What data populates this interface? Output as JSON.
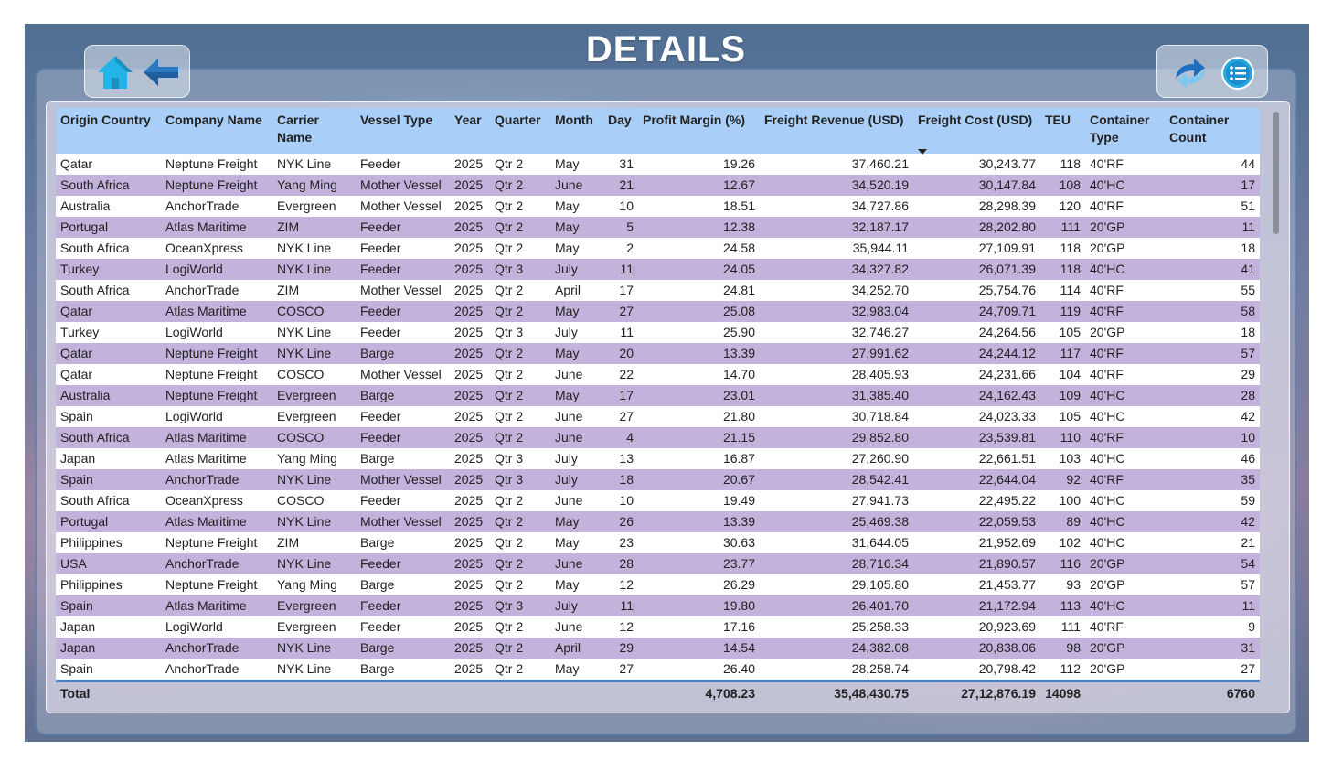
{
  "page": {
    "title": "DETAILS"
  },
  "nav": {
    "home_icon": "home-icon",
    "back_icon": "back-arrow-icon"
  },
  "tools": {
    "refresh_icon": "refresh-icon",
    "menu_icon": "list-menu-icon"
  },
  "colors": {
    "header_bg": "#a9cff8",
    "row_alt": "#c3b3dc",
    "row_base": "#ffffff",
    "total_rule": "#3b7fd0",
    "title": "#ffffff"
  },
  "table": {
    "columns": [
      "Origin Country",
      "Company Name",
      "Carrier Name",
      "Vessel Type",
      "Year",
      "Quarter",
      "Month",
      "Day",
      "Profit Margin (%)",
      "Freight Revenue (USD)",
      "Freight Cost (USD)",
      "TEU",
      "Container Type",
      "Container Count"
    ],
    "sorted_column": "Freight Cost (USD)",
    "sort_direction": "descending",
    "rows": [
      [
        "Qatar",
        "Neptune Freight",
        "NYK Line",
        "Feeder",
        "2025",
        "Qtr 2",
        "May",
        "31",
        "19.26",
        "37,460.21",
        "30,243.77",
        "118",
        "40'RF",
        "44"
      ],
      [
        "South Africa",
        "Neptune Freight",
        "Yang Ming",
        "Mother Vessel",
        "2025",
        "Qtr 2",
        "June",
        "21",
        "12.67",
        "34,520.19",
        "30,147.84",
        "108",
        "40'HC",
        "17"
      ],
      [
        "Australia",
        "AnchorTrade",
        "Evergreen",
        "Mother Vessel",
        "2025",
        "Qtr 2",
        "May",
        "10",
        "18.51",
        "34,727.86",
        "28,298.39",
        "120",
        "40'RF",
        "51"
      ],
      [
        "Portugal",
        "Atlas Maritime",
        "ZIM",
        "Feeder",
        "2025",
        "Qtr 2",
        "May",
        "5",
        "12.38",
        "32,187.17",
        "28,202.80",
        "111",
        "20'GP",
        "11"
      ],
      [
        "South Africa",
        "OceanXpress",
        "NYK Line",
        "Feeder",
        "2025",
        "Qtr 2",
        "May",
        "2",
        "24.58",
        "35,944.11",
        "27,109.91",
        "118",
        "20'GP",
        "18"
      ],
      [
        "Turkey",
        "LogiWorld",
        "NYK Line",
        "Feeder",
        "2025",
        "Qtr 3",
        "July",
        "11",
        "24.05",
        "34,327.82",
        "26,071.39",
        "118",
        "40'HC",
        "41"
      ],
      [
        "South Africa",
        "AnchorTrade",
        "ZIM",
        "Mother Vessel",
        "2025",
        "Qtr 2",
        "April",
        "17",
        "24.81",
        "34,252.70",
        "25,754.76",
        "114",
        "40'RF",
        "55"
      ],
      [
        "Qatar",
        "Atlas Maritime",
        "COSCO",
        "Feeder",
        "2025",
        "Qtr 2",
        "May",
        "27",
        "25.08",
        "32,983.04",
        "24,709.71",
        "119",
        "40'RF",
        "58"
      ],
      [
        "Turkey",
        "LogiWorld",
        "NYK Line",
        "Feeder",
        "2025",
        "Qtr 3",
        "July",
        "11",
        "25.90",
        "32,746.27",
        "24,264.56",
        "105",
        "20'GP",
        "18"
      ],
      [
        "Qatar",
        "Neptune Freight",
        "NYK Line",
        "Barge",
        "2025",
        "Qtr 2",
        "May",
        "20",
        "13.39",
        "27,991.62",
        "24,244.12",
        "117",
        "40'RF",
        "57"
      ],
      [
        "Qatar",
        "Neptune Freight",
        "COSCO",
        "Mother Vessel",
        "2025",
        "Qtr 2",
        "June",
        "22",
        "14.70",
        "28,405.93",
        "24,231.66",
        "104",
        "40'RF",
        "29"
      ],
      [
        "Australia",
        "Neptune Freight",
        "Evergreen",
        "Barge",
        "2025",
        "Qtr 2",
        "May",
        "17",
        "23.01",
        "31,385.40",
        "24,162.43",
        "109",
        "40'HC",
        "28"
      ],
      [
        "Spain",
        "LogiWorld",
        "Evergreen",
        "Feeder",
        "2025",
        "Qtr 2",
        "June",
        "27",
        "21.80",
        "30,718.84",
        "24,023.33",
        "105",
        "40'HC",
        "42"
      ],
      [
        "South Africa",
        "Atlas Maritime",
        "COSCO",
        "Feeder",
        "2025",
        "Qtr 2",
        "June",
        "4",
        "21.15",
        "29,852.80",
        "23,539.81",
        "110",
        "40'RF",
        "10"
      ],
      [
        "Japan",
        "Atlas Maritime",
        "Yang Ming",
        "Barge",
        "2025",
        "Qtr 3",
        "July",
        "13",
        "16.87",
        "27,260.90",
        "22,661.51",
        "103",
        "40'HC",
        "46"
      ],
      [
        "Spain",
        "AnchorTrade",
        "NYK Line",
        "Mother Vessel",
        "2025",
        "Qtr 3",
        "July",
        "18",
        "20.67",
        "28,542.41",
        "22,644.04",
        "92",
        "40'RF",
        "35"
      ],
      [
        "South Africa",
        "OceanXpress",
        "COSCO",
        "Feeder",
        "2025",
        "Qtr 2",
        "June",
        "10",
        "19.49",
        "27,941.73",
        "22,495.22",
        "100",
        "40'HC",
        "59"
      ],
      [
        "Portugal",
        "Atlas Maritime",
        "NYK Line",
        "Mother Vessel",
        "2025",
        "Qtr 2",
        "May",
        "26",
        "13.39",
        "25,469.38",
        "22,059.53",
        "89",
        "40'HC",
        "42"
      ],
      [
        "Philippines",
        "Neptune Freight",
        "ZIM",
        "Barge",
        "2025",
        "Qtr 2",
        "May",
        "23",
        "30.63",
        "31,644.05",
        "21,952.69",
        "102",
        "40'HC",
        "21"
      ],
      [
        "USA",
        "AnchorTrade",
        "NYK Line",
        "Feeder",
        "2025",
        "Qtr 2",
        "June",
        "28",
        "23.77",
        "28,716.34",
        "21,890.57",
        "116",
        "20'GP",
        "54"
      ],
      [
        "Philippines",
        "Neptune Freight",
        "Yang Ming",
        "Barge",
        "2025",
        "Qtr 2",
        "May",
        "12",
        "26.29",
        "29,105.80",
        "21,453.77",
        "93",
        "20'GP",
        "57"
      ],
      [
        "Spain",
        "Atlas Maritime",
        "Evergreen",
        "Feeder",
        "2025",
        "Qtr 3",
        "July",
        "11",
        "19.80",
        "26,401.70",
        "21,172.94",
        "113",
        "40'HC",
        "11"
      ],
      [
        "Japan",
        "LogiWorld",
        "Evergreen",
        "Feeder",
        "2025",
        "Qtr 2",
        "June",
        "12",
        "17.16",
        "25,258.33",
        "20,923.69",
        "111",
        "40'RF",
        "9"
      ],
      [
        "Japan",
        "AnchorTrade",
        "NYK Line",
        "Barge",
        "2025",
        "Qtr 2",
        "April",
        "29",
        "14.54",
        "24,382.08",
        "20,838.06",
        "98",
        "20'GP",
        "31"
      ],
      [
        "Spain",
        "AnchorTrade",
        "NYK Line",
        "Barge",
        "2025",
        "Qtr 2",
        "May",
        "27",
        "26.40",
        "28,258.74",
        "20,798.42",
        "112",
        "20'GP",
        "27"
      ]
    ],
    "total": {
      "label": "Total",
      "profit_margin": "4,708.23",
      "freight_revenue": "35,48,430.75",
      "freight_cost": "27,12,876.19",
      "teu": "14098",
      "container_count": "6760"
    },
    "scroll_position": 0.0
  }
}
